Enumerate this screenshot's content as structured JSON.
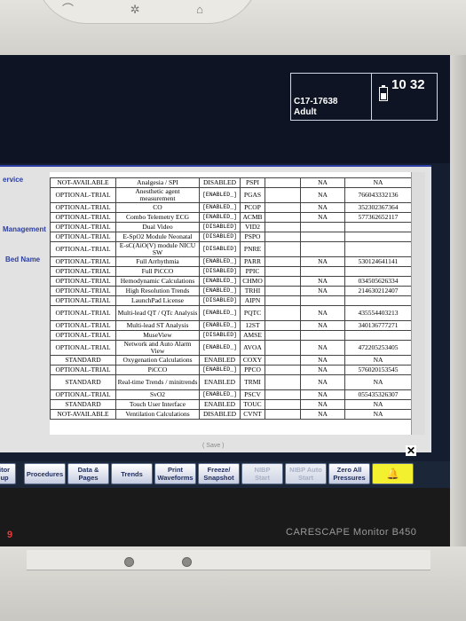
{
  "window": {
    "patient_bed": "C17-17638",
    "patient_category": "Adult",
    "clock": "10 32",
    "battery_icon": "battery-icon"
  },
  "side_labels": {
    "service": "ervice",
    "management": "Management",
    "bed_name": "Bed Name"
  },
  "table": {
    "rows": [
      {
        "status": "NOT-AVAILABLE",
        "name": "Analgesia / SPI",
        "state": "DISABLED",
        "code": "PSPI",
        "t1": "",
        "trial": "NA",
        "key": "NA"
      },
      {
        "status": "OPTIONAL-TRIAL",
        "name": "Anesthetic agent measurement",
        "state": "[ENABLED_]",
        "code": "PGAS",
        "t1": "",
        "trial": "NA",
        "key": "766043332136"
      },
      {
        "status": "OPTIONAL-TRIAL",
        "name": "CO",
        "state": "[ENABLED_]",
        "code": "PCOP",
        "t1": "",
        "trial": "NA",
        "key": "352302367364"
      },
      {
        "status": "OPTIONAL-TRIAL",
        "name": "Combo Telemetry ECG",
        "state": "[ENABLED_]",
        "code": "ACMB",
        "t1": "",
        "trial": "NA",
        "key": "577362652117"
      },
      {
        "status": "OPTIONAL-TRIAL",
        "name": "Dual Video",
        "state": "[DISABLED]",
        "code": "VID2",
        "t1": "",
        "trial": "",
        "key": ""
      },
      {
        "status": "OPTIONAL-TRIAL",
        "name": "E-SpO2 Module Neonatal",
        "state": "[DISABLED]",
        "code": "PSPO",
        "t1": "",
        "trial": "",
        "key": ""
      },
      {
        "status": "OPTIONAL-TRIAL",
        "name": "E-sC(AiO(V) module NICU SW",
        "state": "[DISABLED]",
        "code": "PNRE",
        "t1": "",
        "trial": "",
        "key": ""
      },
      {
        "status": "OPTIONAL-TRIAL",
        "name": "Full Arrhythmia",
        "state": "[ENABLED_]",
        "code": "PARR",
        "t1": "",
        "trial": "NA",
        "key": "530124641141"
      },
      {
        "status": "OPTIONAL-TRIAL",
        "name": "Full PiCCO",
        "state": "[DISABLED]",
        "code": "PPIC",
        "t1": "",
        "trial": "",
        "key": ""
      },
      {
        "status": "OPTIONAL-TRIAL",
        "name": "Hemodynamic Calculations",
        "state": "[ENABLED_]",
        "code": "CHMO",
        "t1": "",
        "trial": "NA",
        "key": "034505626334"
      },
      {
        "status": "OPTIONAL-TRIAL",
        "name": "High Resolution Trends",
        "state": "[ENABLED_]",
        "code": "TRHI",
        "t1": "",
        "trial": "NA",
        "key": "214630212407"
      },
      {
        "status": "OPTIONAL-TRIAL",
        "name": "LaunchPad License",
        "state": "[DISABLED]",
        "code": "AIPN",
        "t1": "",
        "trial": "",
        "key": ""
      },
      {
        "status": "OPTIONAL-TRIAL",
        "name": "Multi-lead QT / QTc Analysis",
        "state": "[ENABLED_]",
        "code": "PQTC",
        "t1": "",
        "trial": "NA",
        "key": "435554403213"
      },
      {
        "status": "OPTIONAL-TRIAL",
        "name": "Multi-lead ST Analysis",
        "state": "[ENABLED_]",
        "code": "12ST",
        "t1": "",
        "trial": "NA",
        "key": "340136777271"
      },
      {
        "status": "OPTIONAL-TRIAL",
        "name": "MuseView",
        "state": "[DISABLED]",
        "code": "AMSE",
        "t1": "",
        "trial": "",
        "key": ""
      },
      {
        "status": "OPTIONAL-TRIAL",
        "name": "Network and Auto Alarm View",
        "state": "[ENABLED_]",
        "code": "AVOA",
        "t1": "",
        "trial": "NA",
        "key": "472205253405"
      },
      {
        "status": "STANDARD",
        "name": "Oxygenation Calculations",
        "state": "ENABLED",
        "code": "COXY",
        "t1": "",
        "trial": "NA",
        "key": "NA"
      },
      {
        "status": "OPTIONAL-TRIAL",
        "name": "PiCCO",
        "state": "[ENABLED_]",
        "code": "PPCO",
        "t1": "",
        "trial": "NA",
        "key": "576020153545"
      },
      {
        "status": "STANDARD",
        "name": "Real-time Trends / minitrends",
        "state": "ENABLED",
        "code": "TRMI",
        "t1": "",
        "trial": "NA",
        "key": "NA"
      },
      {
        "status": "OPTIONAL-TRIAL",
        "name": "SvO2",
        "state": "[ENABLED_]",
        "code": "PSCV",
        "t1": "",
        "trial": "NA",
        "key": "055435326307"
      },
      {
        "status": "STANDARD",
        "name": "Touch User Interface",
        "state": "ENABLED",
        "code": "TOUC",
        "t1": "",
        "trial": "NA",
        "key": "NA"
      },
      {
        "status": "NOT-AVAILABLE",
        "name": "Ventilation Calculations",
        "state": "DISABLED",
        "code": "CVNT",
        "t1": "",
        "trial": "NA",
        "key": "NA"
      }
    ],
    "save_label": "( Save )"
  },
  "menu": {
    "monitor_setup": "itor\nup",
    "procedures": "Procedures",
    "data_pages": "Data &\nPages",
    "trends": "Trends",
    "print_waveforms": "Print\nWaveforms",
    "freeze_snapshot": "Freeze/\nSnapshot",
    "nibp_start": "NIBP\nStart",
    "nibp_auto_start": "NIBP Auto\nStart",
    "zero_all_pressures": "Zero All\nPressures",
    "alarm_icon": "alarm-bell-icon"
  },
  "device": {
    "brand": "CARESCAPE Monitor B450",
    "led": "9"
  }
}
